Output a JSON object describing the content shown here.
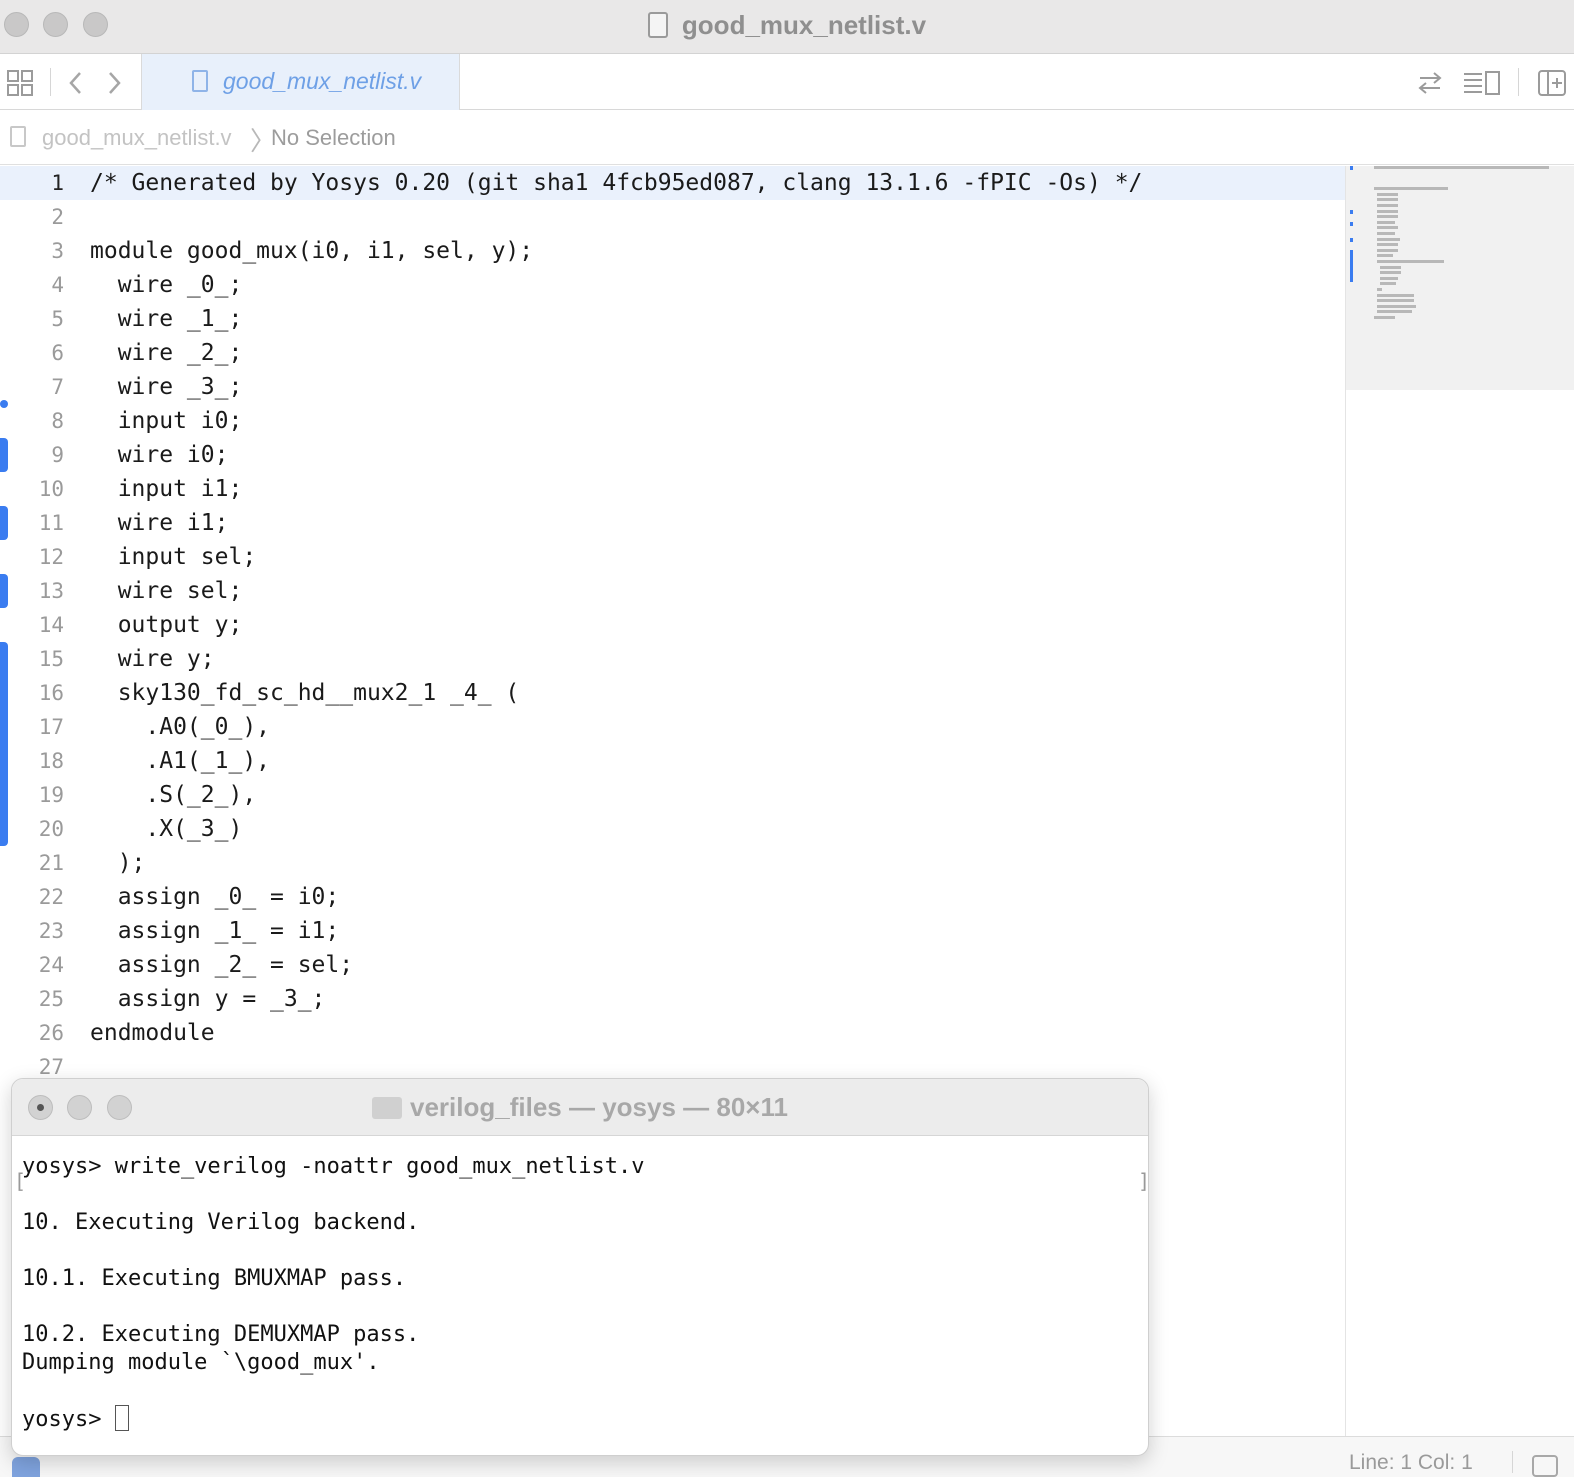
{
  "window": {
    "title": "good_mux_netlist.v"
  },
  "toolbar": {
    "tab_label": "good_mux_netlist.v"
  },
  "breadcrumb": {
    "file": "good_mux_netlist.v",
    "selection": "No Selection"
  },
  "editor": {
    "lines": [
      {
        "n": "1",
        "text": "/* Generated by Yosys 0.20 (git sha1 4fcb95ed087, clang 13.1.6 -fPIC -Os) */"
      },
      {
        "n": "2",
        "text": ""
      },
      {
        "n": "3",
        "text": "module good_mux(i0, i1, sel, y);"
      },
      {
        "n": "4",
        "text": "  wire _0_;"
      },
      {
        "n": "5",
        "text": "  wire _1_;"
      },
      {
        "n": "6",
        "text": "  wire _2_;"
      },
      {
        "n": "7",
        "text": "  wire _3_;"
      },
      {
        "n": "8",
        "text": "  input i0;"
      },
      {
        "n": "9",
        "text": "  wire i0;"
      },
      {
        "n": "10",
        "text": "  input i1;"
      },
      {
        "n": "11",
        "text": "  wire i1;"
      },
      {
        "n": "12",
        "text": "  input sel;"
      },
      {
        "n": "13",
        "text": "  wire sel;"
      },
      {
        "n": "14",
        "text": "  output y;"
      },
      {
        "n": "15",
        "text": "  wire y;"
      },
      {
        "n": "16",
        "text": "  sky130_fd_sc_hd__mux2_1 _4_ ("
      },
      {
        "n": "17",
        "text": "    .A0(_0_),"
      },
      {
        "n": "18",
        "text": "    .A1(_1_),"
      },
      {
        "n": "19",
        "text": "    .S(_2_),"
      },
      {
        "n": "20",
        "text": "    .X(_3_)"
      },
      {
        "n": "21",
        "text": "  );"
      },
      {
        "n": "22",
        "text": "  assign _0_ = i0;"
      },
      {
        "n": "23",
        "text": "  assign _1_ = i1;"
      },
      {
        "n": "24",
        "text": "  assign _2_ = sel;"
      },
      {
        "n": "25",
        "text": "  assign y = _3_;"
      },
      {
        "n": "26",
        "text": "endmodule"
      },
      {
        "n": "27",
        "text": ""
      }
    ]
  },
  "terminal": {
    "title": "verilog_files — yosys — 80×11",
    "lines": [
      "yosys> write_verilog -noattr good_mux_netlist.v",
      "",
      "10. Executing Verilog backend.",
      "",
      "10.1. Executing BMUXMAP pass.",
      "",
      "10.2. Executing DEMUXMAP pass.",
      "Dumping module `\\good_mux'.",
      "",
      "yosys> "
    ]
  },
  "status": {
    "position": "Line: 1  Col: 1"
  },
  "colors": {
    "accent": "#3a7cf0",
    "active_line": "#eaf1fc"
  }
}
